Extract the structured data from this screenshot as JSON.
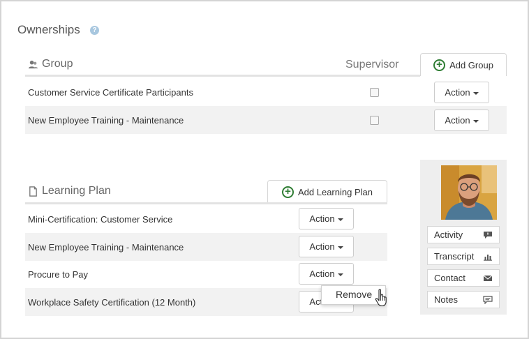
{
  "title": "Ownerships",
  "help_icon_glyph": "?",
  "group": {
    "header": "Group",
    "supervisor_header": "Supervisor",
    "add_label": "Add Group",
    "rows": [
      {
        "name": "Customer Service Certificate Participants",
        "supervisor": false,
        "action": "Action"
      },
      {
        "name": "New Employee Training - Maintenance",
        "supervisor": false,
        "action": "Action"
      }
    ]
  },
  "learning_plan": {
    "header": "Learning Plan",
    "add_label": "Add Learning Plan",
    "rows": [
      {
        "name": "Mini-Certification: Customer Service",
        "action": "Action"
      },
      {
        "name": "New Employee Training - Maintenance",
        "action": "Action"
      },
      {
        "name": "Procure to Pay",
        "action": "Action"
      },
      {
        "name": "Workplace Safety Certification (12 Month)",
        "action": "Action"
      }
    ],
    "dropdown_item": "Remove"
  },
  "profile": {
    "buttons": [
      {
        "label": "Activity",
        "icon": "speech-bubble-icon"
      },
      {
        "label": "Transcript",
        "icon": "bar-chart-icon"
      },
      {
        "label": "Contact",
        "icon": "envelope-icon"
      },
      {
        "label": "Notes",
        "icon": "note-bubble-icon"
      }
    ]
  },
  "colors": {
    "accent_green": "#2f7d34",
    "row_alt": "#f2f2f2",
    "card_bg": "#eeeeee"
  }
}
